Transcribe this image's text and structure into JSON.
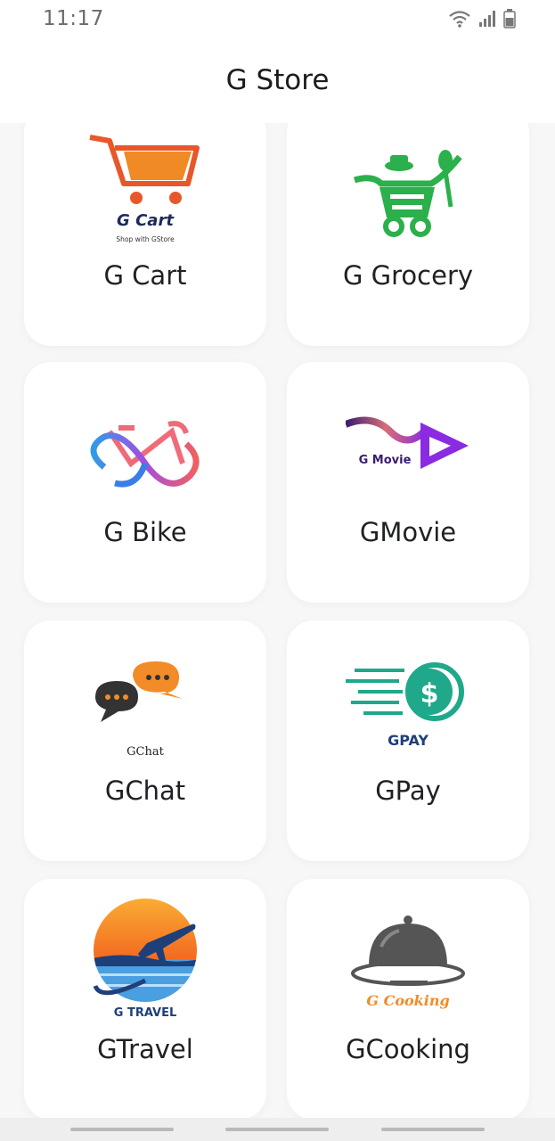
{
  "status_bar": {
    "time": "11:17"
  },
  "header": {
    "title": "G Store"
  },
  "apps": [
    {
      "label": "G Cart",
      "logo_text": "G Cart",
      "logo_subtext": "Shop with GStore"
    },
    {
      "label": "G Grocery"
    },
    {
      "label": "G Bike"
    },
    {
      "label": "GMovie",
      "logo_text": "G Movie"
    },
    {
      "label": "GChat",
      "logo_text": "GChat"
    },
    {
      "label": "GPay",
      "logo_text": "GPAY"
    },
    {
      "label": "GTravel",
      "logo_text": "G TRAVEL"
    },
    {
      "label": "GCooking",
      "logo_text": "G Cooking"
    }
  ],
  "colors": {
    "cart_orange": "#e8572a",
    "grocery_green": "#2bb04b",
    "movie_purple": "#8a2be2",
    "chat_orange": "#f28c28",
    "pay_teal": "#1fa88a",
    "travel_blue": "#1f3f7a",
    "cooking_gray": "#555555"
  }
}
